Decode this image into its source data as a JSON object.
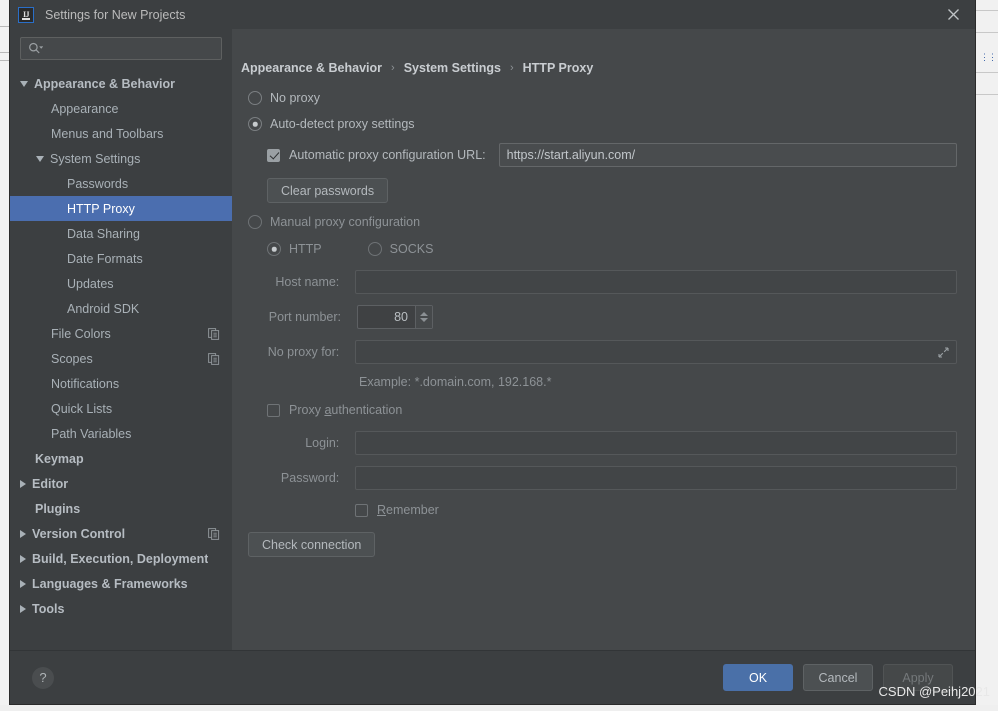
{
  "window": {
    "title": "Settings for New Projects",
    "app_icon": "intellij-idea-icon",
    "close_icon": "close-icon"
  },
  "sidebar": {
    "search": {
      "placeholder": "",
      "icon": "search-icon"
    },
    "items": [
      {
        "label": "Appearance & Behavior",
        "arrow": "down",
        "bold": true,
        "indent": 0,
        "selected": false,
        "copy": false
      },
      {
        "label": "Appearance",
        "arrow": "none",
        "bold": false,
        "indent": 1,
        "selected": false,
        "copy": false
      },
      {
        "label": "Menus and Toolbars",
        "arrow": "none",
        "bold": false,
        "indent": 1,
        "selected": false,
        "copy": false
      },
      {
        "label": "System Settings",
        "arrow": "down",
        "bold": false,
        "indent": 1,
        "selected": false,
        "copy": false
      },
      {
        "label": "Passwords",
        "arrow": "none",
        "bold": false,
        "indent": 2,
        "selected": false,
        "copy": false
      },
      {
        "label": "HTTP Proxy",
        "arrow": "none",
        "bold": false,
        "indent": 2,
        "selected": true,
        "copy": false
      },
      {
        "label": "Data Sharing",
        "arrow": "none",
        "bold": false,
        "indent": 2,
        "selected": false,
        "copy": false
      },
      {
        "label": "Date Formats",
        "arrow": "none",
        "bold": false,
        "indent": 2,
        "selected": false,
        "copy": false
      },
      {
        "label": "Updates",
        "arrow": "none",
        "bold": false,
        "indent": 2,
        "selected": false,
        "copy": false
      },
      {
        "label": "Android SDK",
        "arrow": "none",
        "bold": false,
        "indent": 2,
        "selected": false,
        "copy": false
      },
      {
        "label": "File Colors",
        "arrow": "none",
        "bold": false,
        "indent": 1,
        "selected": false,
        "copy": true
      },
      {
        "label": "Scopes",
        "arrow": "none",
        "bold": false,
        "indent": 1,
        "selected": false,
        "copy": true
      },
      {
        "label": "Notifications",
        "arrow": "none",
        "bold": false,
        "indent": 1,
        "selected": false,
        "copy": false
      },
      {
        "label": "Quick Lists",
        "arrow": "none",
        "bold": false,
        "indent": 1,
        "selected": false,
        "copy": false
      },
      {
        "label": "Path Variables",
        "arrow": "none",
        "bold": false,
        "indent": 1,
        "selected": false,
        "copy": false
      },
      {
        "label": "Keymap",
        "arrow": "none",
        "bold": true,
        "indent": 0,
        "selected": false,
        "copy": false
      },
      {
        "label": "Editor",
        "arrow": "right",
        "bold": true,
        "indent": 0,
        "selected": false,
        "copy": false
      },
      {
        "label": "Plugins",
        "arrow": "none",
        "bold": true,
        "indent": 0,
        "selected": false,
        "copy": false
      },
      {
        "label": "Version Control",
        "arrow": "right",
        "bold": true,
        "indent": 0,
        "selected": false,
        "copy": true
      },
      {
        "label": "Build, Execution, Deployment",
        "arrow": "right",
        "bold": true,
        "indent": 0,
        "selected": false,
        "copy": false
      },
      {
        "label": "Languages & Frameworks",
        "arrow": "right",
        "bold": true,
        "indent": 0,
        "selected": false,
        "copy": false
      },
      {
        "label": "Tools",
        "arrow": "right",
        "bold": true,
        "indent": 0,
        "selected": false,
        "copy": false
      }
    ]
  },
  "main": {
    "breadcrumb": [
      "Appearance & Behavior",
      "System Settings",
      "HTTP Proxy"
    ],
    "breadcrumb_separator": "›",
    "no_proxy": {
      "label": "No proxy",
      "checked": false
    },
    "auto_detect": {
      "label": "Auto-detect proxy settings",
      "checked": true
    },
    "auto_config": {
      "label": "Automatic proxy configuration URL:",
      "checked": true,
      "url_value": "https://start.aliyun.com/",
      "url_placeholder": ""
    },
    "clear_passwords_label": "Clear passwords",
    "manual_proxy": {
      "label": "Manual proxy configuration",
      "checked": false
    },
    "protocol": {
      "http": {
        "label": "HTTP",
        "checked": true
      },
      "socks": {
        "label": "SOCKS",
        "checked": false
      }
    },
    "host_name": {
      "label": "Host name:",
      "value": "",
      "placeholder": ""
    },
    "port_number": {
      "label": "Port number:",
      "value": "80",
      "spinner_icon": "spinner-arrows-icon"
    },
    "no_proxy_for": {
      "label": "No proxy for:",
      "value": "",
      "expand_icon": "expand-editor-icon"
    },
    "example_text": "Example: *.domain.com, 192.168.*",
    "proxy_auth": {
      "label": "Proxy authentication",
      "mnemonic": "a",
      "checked": false
    },
    "login": {
      "label": "Login:",
      "value": "",
      "placeholder": ""
    },
    "password": {
      "label": "Password:",
      "value": "",
      "placeholder": ""
    },
    "remember": {
      "label": "Remember",
      "mnemonic": "R",
      "checked": false
    },
    "check_connection_label": "Check connection"
  },
  "footer": {
    "help_icon": "help-question-icon",
    "ok_label": "OK",
    "cancel_label": "Cancel",
    "apply_label": "Apply",
    "apply_disabled": true
  },
  "watermark": "CSDN @Peihj2021",
  "colors": {
    "dialog_bg": "#45484a",
    "sidebar_bg": "#3c3f41",
    "selection_blue": "#4b6eaf",
    "primary_button": "#4a70a8",
    "text": "#b4b9bd"
  }
}
